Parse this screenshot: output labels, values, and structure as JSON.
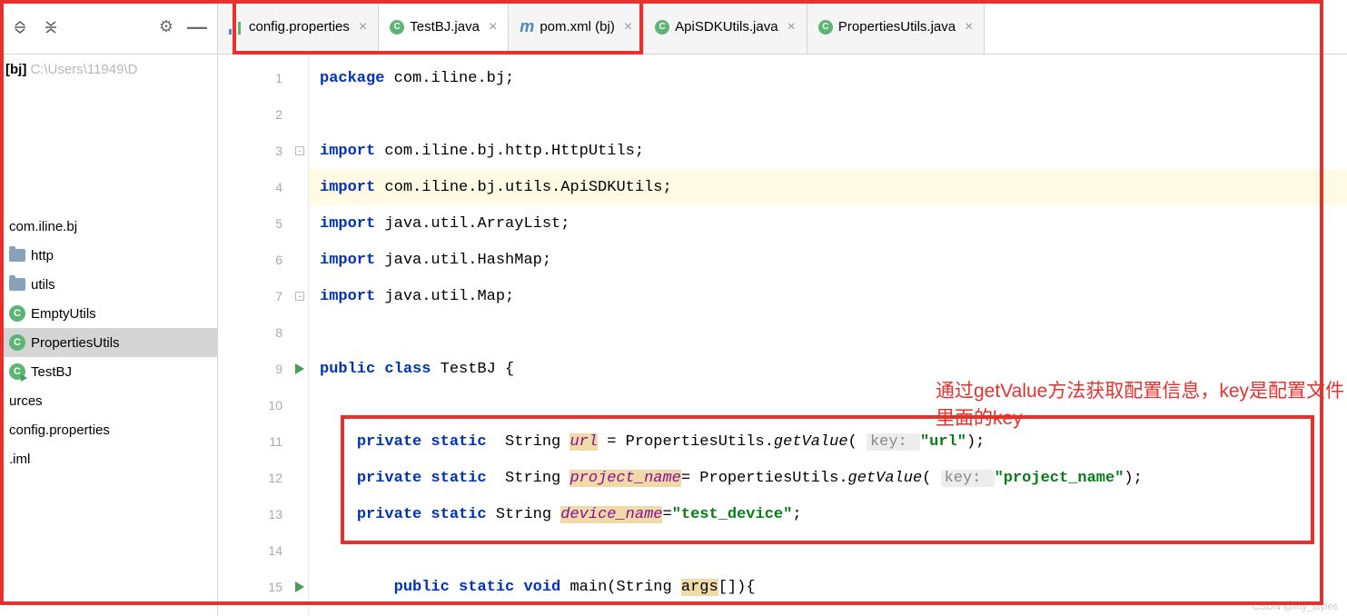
{
  "toolbar": {
    "expand": "⇱",
    "collapse": "⇲"
  },
  "breadcrumb": {
    "project": "[bj]",
    "path": "C:\\Users\\11949\\D"
  },
  "tree": {
    "pkg": "com.iline.bj",
    "http": "http",
    "utils": "utils",
    "empty": "EmptyUtils",
    "props": "PropertiesUtils",
    "testbj": "TestBJ",
    "urces": "urces",
    "config": "config.properties",
    "iml": ".iml"
  },
  "tabs": {
    "config": "config.properties",
    "testbj": "TestBJ.java",
    "pom": "pom.xml (bj)",
    "api": "ApiSDKUtils.java",
    "putils": "PropertiesUtils.java"
  },
  "gutter": {
    "l1": "1",
    "l2": "2",
    "l3": "3",
    "l4": "4",
    "l5": "5",
    "l6": "6",
    "l7": "7",
    "l8": "8",
    "l9": "9",
    "l10": "10",
    "l11": "11",
    "l12": "12",
    "l13": "13",
    "l14": "14",
    "l15": "15"
  },
  "code": {
    "l1_kw": "package ",
    "l1_rest": "com.iline.bj;",
    "l3_kw": "import ",
    "l3_rest": "com.iline.bj.http.HttpUtils;",
    "l4_kw": "import ",
    "l4_rest": "com.iline.bj.utils.ApiSDKUtils;",
    "l5_kw": "import ",
    "l5_rest": "java.util.ArrayList;",
    "l6_kw": "import ",
    "l6_rest": "java.util.HashMap;",
    "l7_kw": "import ",
    "l7_rest": "java.util.Map;",
    "l9_pub": "public class ",
    "l9_cls": "TestBJ {",
    "indent1": "    ",
    "indent2": "        ",
    "l11_ps": "private static  ",
    "l11_type": "String ",
    "l11_field": "url",
    "l11_eq": " = PropertiesUtils.",
    "l11_m": "getValue",
    "l11_open": "( ",
    "l11_hint": "key: ",
    "l11_str": "\"url\"",
    "l11_end": ");",
    "l12_ps": "private static  ",
    "l12_type": "String ",
    "l12_field": "project_name",
    "l12_eq": "= PropertiesUtils.",
    "l12_m": "getValue",
    "l12_open": "( ",
    "l12_hint": "key: ",
    "l12_str": "\"project_name\"",
    "l12_end": ");",
    "l13_ps": "private static ",
    "l13_type": "String ",
    "l13_field": "device_name",
    "l13_eq": "=",
    "l13_str": "\"test_device\"",
    "l13_end": ";",
    "l15_psv": "public static void ",
    "l15_main": "main",
    "l15_args1": "(String ",
    "l15_args2": "args",
    "l15_args3": "[]){"
  },
  "annotation": "通过getValue方法获取配置信息，key是配置文件里面的key",
  "watermark": "CSDN @my_styles"
}
